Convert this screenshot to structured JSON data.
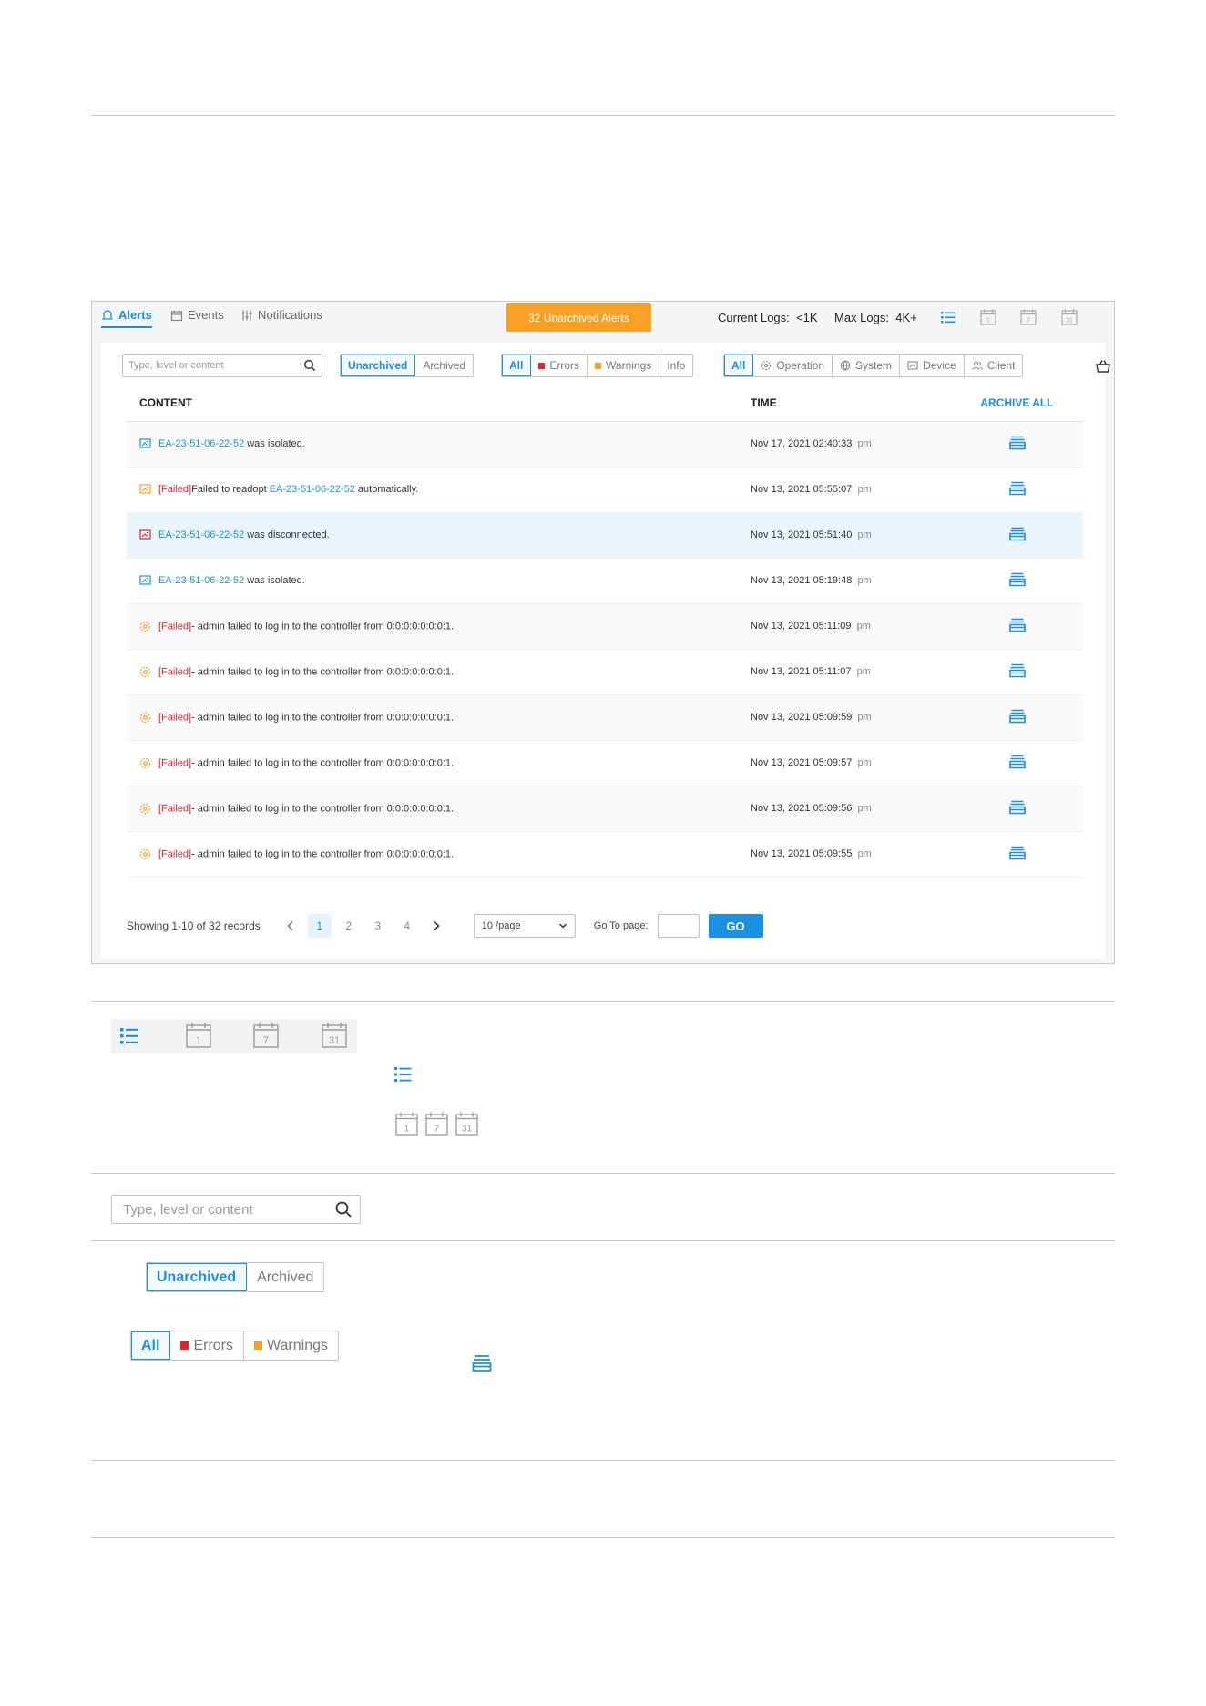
{
  "tabs": [
    {
      "label": "Alerts"
    },
    {
      "label": "Events"
    },
    {
      "label": "Notifications"
    }
  ],
  "unarchived_banner": "32 Unarchived Alerts",
  "logs": {
    "current_label": "Current Logs:",
    "current_value": "<1K",
    "max_label": "Max Logs:",
    "max_value": "4K+"
  },
  "search": {
    "placeholder": "Type, level or content"
  },
  "archive_filter": {
    "unarchived": "Unarchived",
    "archived": "Archived"
  },
  "level_filter": {
    "all": "All",
    "errors": "Errors",
    "warnings": "Warnings",
    "info": "Info"
  },
  "type_filter": {
    "all": "All",
    "operation": "Operation",
    "system": "System",
    "device": "Device",
    "client": "Client"
  },
  "table": {
    "headers": {
      "content": "CONTENT",
      "time": "TIME",
      "archive_all": "ARCHIVE ALL"
    },
    "rows": [
      {
        "icon": "device-icon",
        "prefix": "",
        "link": "EA-23-51-06-22-52",
        "text": " was isolated.",
        "time": "Nov 17, 2021 02:40:33",
        "ampm": "pm"
      },
      {
        "icon": "device-icon",
        "prefix": "[Failed]",
        "text_before": "Failed to readopt ",
        "link": "EA-23-51-06-22-52",
        "text": " automatically.",
        "time": "Nov 13, 2021 05:55:07",
        "ampm": "pm"
      },
      {
        "icon": "device-icon",
        "prefix": "",
        "link": "EA-23-51-06-22-52",
        "text": " was disconnected.",
        "time": "Nov 13, 2021 05:51:40",
        "ampm": "pm"
      },
      {
        "icon": "device-icon",
        "prefix": "",
        "link": "EA-23-51-06-22-52",
        "text": " was isolated.",
        "time": "Nov 13, 2021 05:19:48",
        "ampm": "pm"
      },
      {
        "icon": "operation-icon",
        "prefix": "[Failed]",
        "text": "- admin failed to log in to the controller from 0:0:0:0:0:0:0:1.",
        "time": "Nov 13, 2021 05:11:09",
        "ampm": "pm"
      },
      {
        "icon": "operation-icon",
        "prefix": "[Failed]",
        "text": "- admin failed to log in to the controller from 0:0:0:0:0:0:0:1.",
        "time": "Nov 13, 2021 05:11:07",
        "ampm": "pm"
      },
      {
        "icon": "operation-icon",
        "prefix": "[Failed]",
        "text": "- admin failed to log in to the controller from 0:0:0:0:0:0:0:1.",
        "time": "Nov 13, 2021 05:09:59",
        "ampm": "pm"
      },
      {
        "icon": "operation-icon",
        "prefix": "[Failed]",
        "text": "- admin failed to log in to the controller from 0:0:0:0:0:0:0:1.",
        "time": "Nov 13, 2021 05:09:57",
        "ampm": "pm"
      },
      {
        "icon": "operation-icon",
        "prefix": "[Failed]",
        "text": "- admin failed to log in to the controller from 0:0:0:0:0:0:0:1.",
        "time": "Nov 13, 2021 05:09:56",
        "ampm": "pm"
      },
      {
        "icon": "operation-icon",
        "prefix": "[Failed]",
        "text": "- admin failed to log in to the controller from 0:0:0:0:0:0:0:1.",
        "time": "Nov 13, 2021 05:09:55",
        "ampm": "pm"
      }
    ]
  },
  "pagination": {
    "showing": "Showing 1-10 of 32 records",
    "pages": [
      "1",
      "2",
      "3",
      "4"
    ],
    "current": "1",
    "per_page": "10 /page",
    "goto_label": "Go To page:",
    "go": "GO"
  },
  "calendar_labels": {
    "day": "1",
    "week": "7",
    "month": "31"
  },
  "colors": {
    "accent": "#1b8fe0",
    "warning": "#f7a024",
    "error": "#e3242b"
  }
}
